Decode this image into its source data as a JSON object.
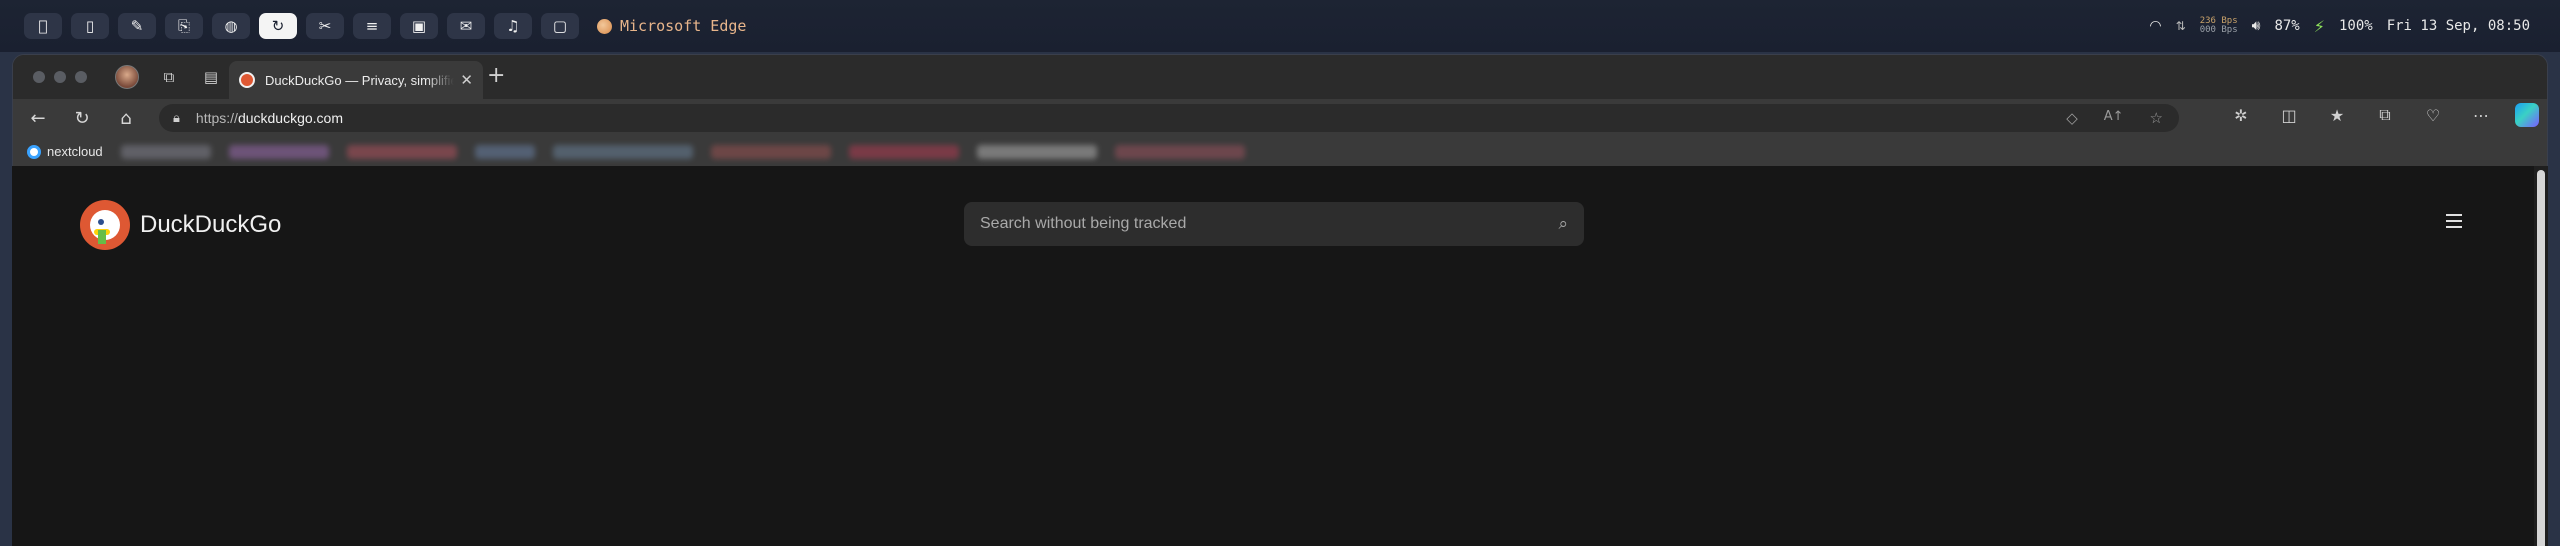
{
  "menubar": {
    "apps": [
      {
        "icon": "apple-icon",
        "glyph": ""
      },
      {
        "icon": "phone-icon",
        "glyph": "▯"
      },
      {
        "icon": "notes-icon",
        "glyph": "✎"
      },
      {
        "icon": "terminal-icon",
        "glyph": "⎘"
      },
      {
        "icon": "globe-icon",
        "glyph": "◍"
      },
      {
        "icon": "edge-icon",
        "glyph": "↻",
        "active": true
      },
      {
        "icon": "tools-icon",
        "glyph": "✂"
      },
      {
        "icon": "database-icon",
        "glyph": "≡"
      },
      {
        "icon": "teams-icon",
        "glyph": "▣"
      },
      {
        "icon": "mail-icon",
        "glyph": "✉"
      },
      {
        "icon": "music-icon",
        "glyph": "♫"
      },
      {
        "icon": "lock-icon",
        "glyph": "▢"
      }
    ],
    "active_app": "Microsoft Edge",
    "net_up": "236 Bps",
    "net_down": "000 Bps",
    "volume": "87%",
    "battery": "100%",
    "datetime": "Fri 13 Sep, 08:50"
  },
  "browser": {
    "tab_title": "DuckDuckGo — Privacy, simplified.",
    "url_prefix": "https://",
    "url_domain": "duckduckgo.com",
    "bookmarks": [
      {
        "label": "nextcloud"
      }
    ]
  },
  "page": {
    "brand": "DuckDuckGo",
    "search_placeholder": "Search without being tracked"
  }
}
